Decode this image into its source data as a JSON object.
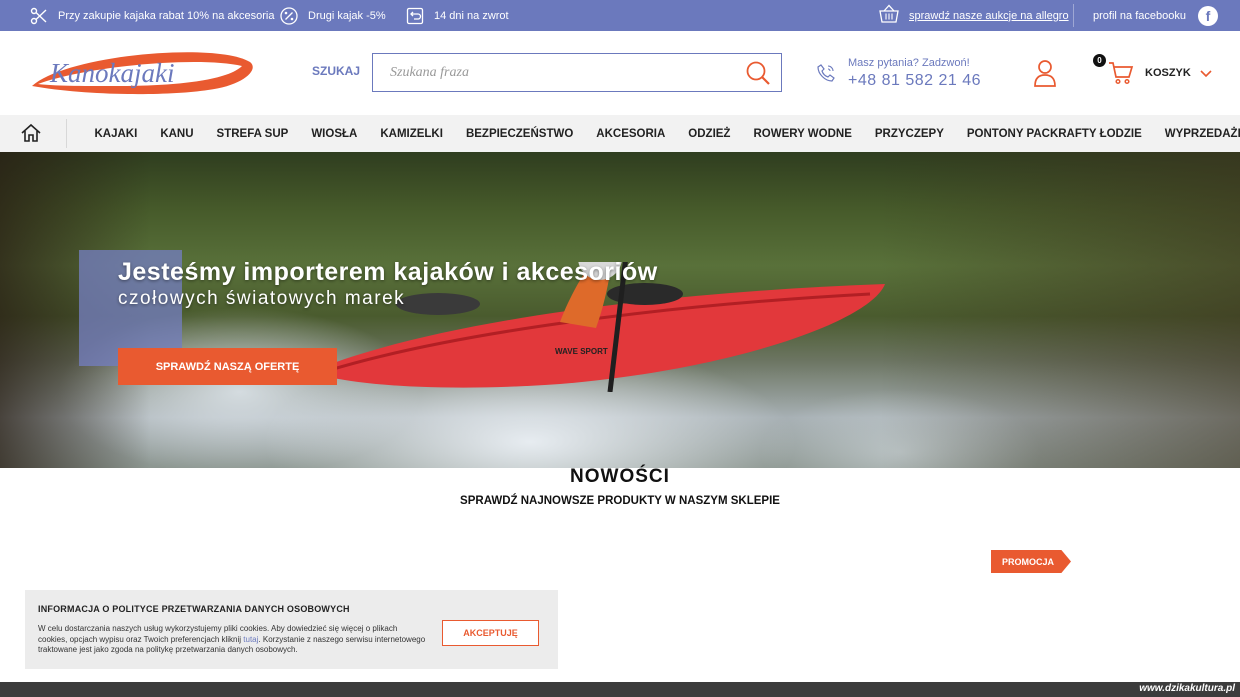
{
  "topbar": {
    "promos": [
      {
        "icon": "scissors-icon",
        "text": "Przy zakupie kajaka rabat 10% na akcesoria"
      },
      {
        "icon": "percent-icon",
        "text": "Drugi kajak -5%"
      },
      {
        "icon": "return-icon",
        "text": "14 dni na zwrot"
      }
    ],
    "allegro_text": "sprawdź nasze aukcje na allegro",
    "facebook_text": "profil na facebooku",
    "facebook_glyph": "f"
  },
  "header": {
    "logo_text": "Kanokajaki",
    "search_label": "SZUKAJ",
    "search_placeholder": "Szukana fraza",
    "phone_question": "Masz pytania? Zadzwoń!",
    "phone_number": "+48 81 582 21 46",
    "cart_count": "0",
    "cart_label": "KOSZYK"
  },
  "nav": {
    "items": [
      "KAJAKI",
      "KANU",
      "STREFA SUP",
      "WIOSŁA",
      "KAMIZELKI",
      "BEZPIECZEŃSTWO",
      "AKCESORIA",
      "ODZIEŻ",
      "ROWERY WODNE",
      "PRZYCZEPY",
      "PONTONY PACKRAFTY ŁODZIE",
      "WYPRZEDAŻE"
    ]
  },
  "hero": {
    "title": "Jesteśmy importerem kajaków i akcesoriów",
    "subtitle": "czołowych światowych marek",
    "cta": "SPRAWDŹ NASZĄ OFERTĘ",
    "kayak_brand": "WAVE SPORT"
  },
  "news": {
    "title": "NOWOŚCI",
    "subtitle": "SPRAWDŹ NAJNOWSZE PRODUKTY W NASZYM SKLEPIE",
    "badge": "PROMOCJA"
  },
  "cookie": {
    "title": "INFORMACJA O POLITYCE PRZETWARZANIA DANYCH OSOBOWYCH",
    "text_before": "W celu dostarczania naszych usług wykorzystujemy pliki cookies. Aby dowiedzieć się więcej o plikach cookies, opcjach wypisu oraz Twoich preferencjach kliknij ",
    "link": "tutaj",
    "text_after": ". Korzystanie z naszego serwisu internetowego traktowane jest jako zgoda na politykę przetwarzania danych osobowych.",
    "accept": "AKCEPTUJĘ"
  },
  "footer": {
    "watermark": "www.dzikakultura.pl"
  },
  "colors": {
    "brand_blue": "#6b79bd",
    "accent_orange": "#e95a30",
    "nav_bg": "#f2f2f2"
  }
}
